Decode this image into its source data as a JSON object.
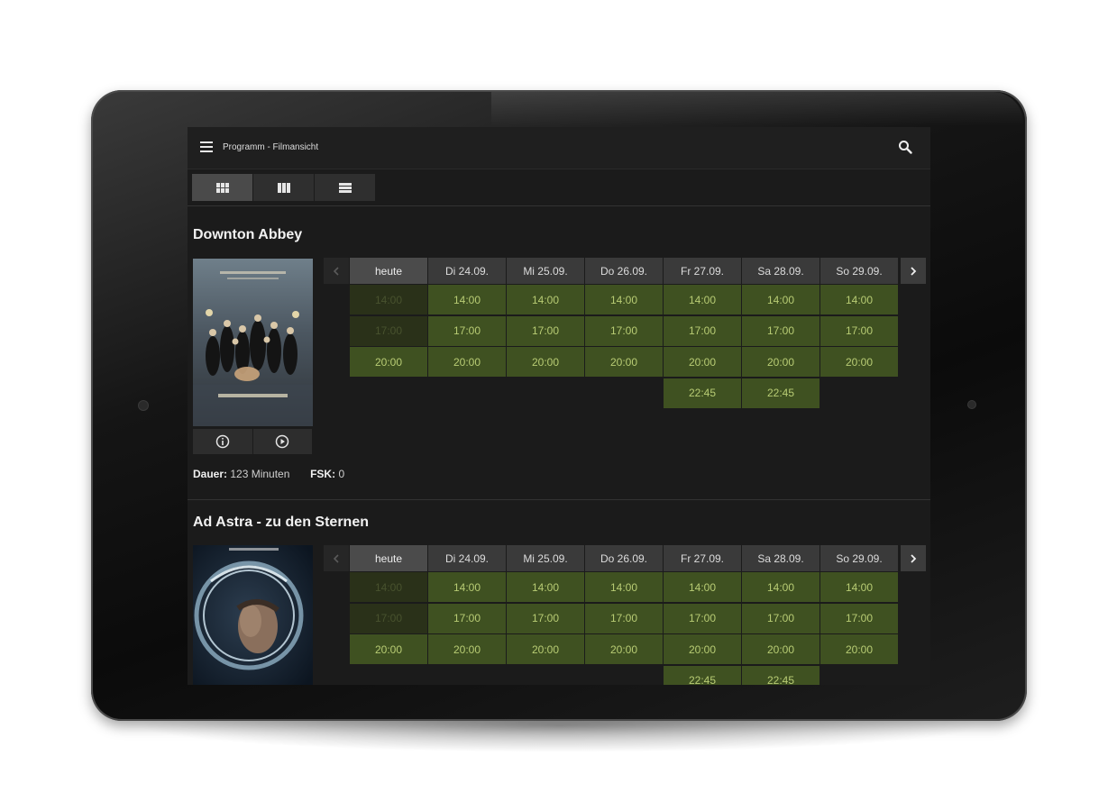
{
  "header": {
    "breadcrumb": "Programm - Filmansicht"
  },
  "colors": {
    "background": "#1b1b1b",
    "slot": "#3f5121",
    "slot_text": "#b8cc74",
    "slot_past": "#2a3119",
    "header_cell": "#3a3a3a"
  },
  "days": [
    "heute",
    "Di 24.09.",
    "Mi 25.09.",
    "Do 26.09.",
    "Fr 27.09.",
    "Sa 28.09.",
    "So 29.09."
  ],
  "movies": [
    {
      "title": "Downton Abbey",
      "duration_label": "Dauer:",
      "duration": "123 Minuten",
      "fsk_label": "FSK:",
      "fsk": "0",
      "grid": [
        [
          "14:00",
          "17:00",
          "20:00",
          ""
        ],
        [
          "14:00",
          "17:00",
          "20:00",
          ""
        ],
        [
          "14:00",
          "17:00",
          "20:00",
          ""
        ],
        [
          "14:00",
          "17:00",
          "20:00",
          ""
        ],
        [
          "14:00",
          "17:00",
          "20:00",
          "22:45"
        ],
        [
          "14:00",
          "17:00",
          "20:00",
          "22:45"
        ],
        [
          "14:00",
          "17:00",
          "20:00",
          ""
        ]
      ],
      "past_slots": [
        "0-0",
        "0-1"
      ]
    },
    {
      "title": "Ad Astra - zu den Sternen",
      "grid": [
        [
          "14:00",
          "17:00",
          "20:00",
          ""
        ],
        [
          "14:00",
          "17:00",
          "20:00",
          ""
        ],
        [
          "14:00",
          "17:00",
          "20:00",
          ""
        ],
        [
          "14:00",
          "17:00",
          "20:00",
          ""
        ],
        [
          "14:00",
          "17:00",
          "20:00",
          "22:45"
        ],
        [
          "14:00",
          "17:00",
          "20:00",
          "22:45"
        ],
        [
          "14:00",
          "17:00",
          "20:00",
          ""
        ]
      ],
      "past_slots": [
        "0-0",
        "0-1"
      ]
    }
  ],
  "icons": {
    "menu": "menu-icon",
    "search": "search-icon",
    "views": [
      "grid-view-icon",
      "column-view-icon",
      "list-view-icon"
    ],
    "info": "info-icon",
    "play": "play-icon",
    "prev": "chevron-left-icon",
    "next": "chevron-right-icon"
  }
}
